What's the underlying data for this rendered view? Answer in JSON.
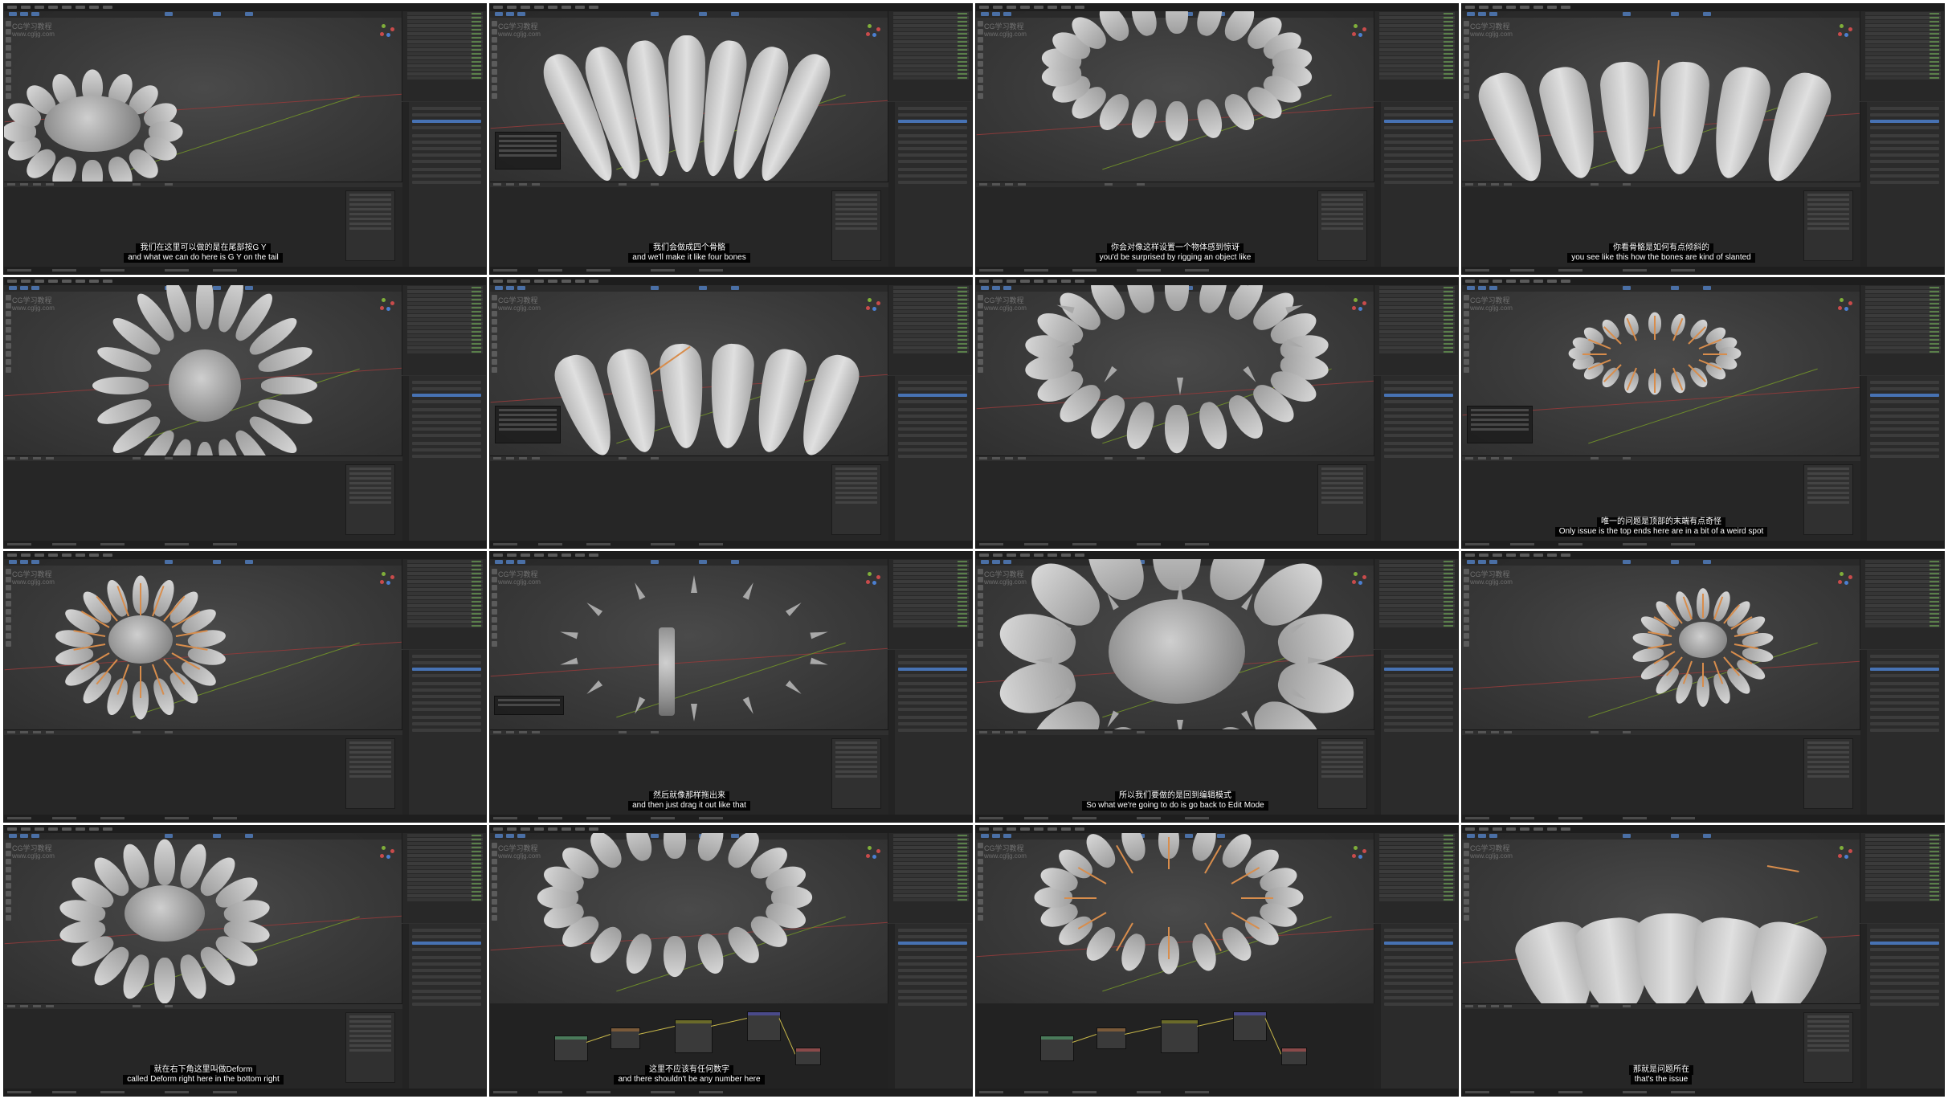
{
  "watermark": {
    "logo": "CG学习教程",
    "url": "www.cgljg.com"
  },
  "colors": {
    "viewport_bg": "#3a3a3a",
    "bone_orange": "#d88d4c",
    "accent_blue": "#4772b3",
    "axis_red": "#8a3b3b",
    "axis_green": "#6c8a2b",
    "subtitle_bg": "#000000",
    "subtitle_text": "#ffffff"
  },
  "tiles": [
    {
      "scene": "flower-side-tilted",
      "subtitle_zh": "我们在这里可以做的是在尾部按G Y",
      "subtitle_en": "and what we can do here is G Y on the tail"
    },
    {
      "scene": "petals-closeup-top",
      "subtitle_zh": "我们会做成四个骨骼",
      "subtitle_en": "and we'll make it like four bones"
    },
    {
      "scene": "flower-ring-side",
      "subtitle_zh": "你会对像这样设置一个物体感到惊讶",
      "subtitle_en": "you'd be surprised by rigging an object like"
    },
    {
      "scene": "petals-bone-closeup",
      "subtitle_zh": "你看骨骼是如何有点倾斜的",
      "subtitle_en": "you see like this how the bones are kind of slanted"
    },
    {
      "scene": "flower-top-view",
      "subtitle_zh": "",
      "subtitle_en": ""
    },
    {
      "scene": "petals-arc-closeup",
      "subtitle_zh": "",
      "subtitle_en": ""
    },
    {
      "scene": "flower-spikes-side",
      "subtitle_zh": "",
      "subtitle_en": ""
    },
    {
      "scene": "flower-bones-far",
      "subtitle_zh": "唯一的问题是顶部的末端有点奇怪",
      "subtitle_en": "Only issue is the top ends here are in a bit of a weird spot"
    },
    {
      "scene": "flower-bones-orange",
      "subtitle_zh": "",
      "subtitle_en": ""
    },
    {
      "scene": "bones-inside-closeup",
      "subtitle_zh": "然后就像那样拖出来",
      "subtitle_en": "and then just drag it out like that"
    },
    {
      "scene": "flower-center-closeup",
      "subtitle_zh": "所以我们要做的是回到编辑模式",
      "subtitle_en": "So what we're going to do is go back to Edit Mode"
    },
    {
      "scene": "flower-bones-small",
      "subtitle_zh": "",
      "subtitle_en": ""
    },
    {
      "scene": "flower-three-quarter",
      "subtitle_zh": "就在右下角这里叫做Deform",
      "subtitle_en": "called Deform right here in the bottom right"
    },
    {
      "scene": "flower-nodes",
      "subtitle_zh": "这里不应该有任何数字",
      "subtitle_en": "and there shouldn't be any number here"
    },
    {
      "scene": "flower-nodes-bones",
      "subtitle_zh": "",
      "subtitle_en": ""
    },
    {
      "scene": "petals-deformed-closeup",
      "subtitle_zh": "那就是问题所在",
      "subtitle_en": "that's the issue"
    }
  ]
}
